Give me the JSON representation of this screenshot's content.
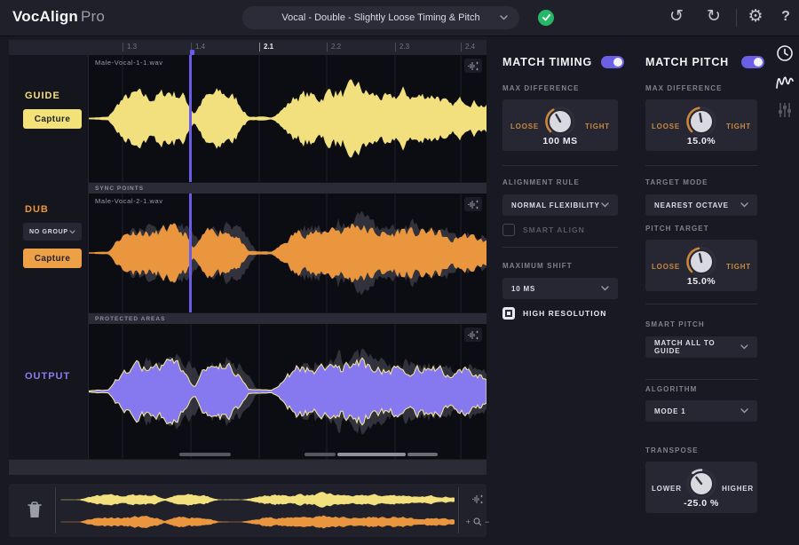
{
  "topbar": {
    "brand": "VocAlign",
    "brand_suffix": "Pro",
    "preset": "Vocal - Double - Slightly Loose Timing & Pitch",
    "icons": {
      "undo": "↺",
      "redo": "↻",
      "gear": "⚙",
      "help": "?"
    }
  },
  "timeline": {
    "ticks": [
      "1.3",
      "1.4",
      "2.1",
      "2.2",
      "2.3",
      "2.4"
    ],
    "active_index": 2
  },
  "tracks": {
    "guide": {
      "label": "GUIDE",
      "file": "Male-Vocal-1-1.wav",
      "capture_label": "Capture",
      "color": "#f1e07d"
    },
    "dub": {
      "label": "DUB",
      "group_value": "NO GROUP",
      "file": "Male-Vocal-2-1.wav",
      "capture_label": "Capture",
      "color": "#e9963f"
    },
    "output": {
      "label": "OUTPUT",
      "color": "#8b7cf0"
    },
    "sync_points_label": "SYNC POINTS",
    "protected_areas_label": "PROTECTED AREAS"
  },
  "match_timing": {
    "title": "MATCH TIMING",
    "enabled": true,
    "max_difference": {
      "label": "MAX DIFFERENCE",
      "loose": "LOOSE",
      "tight": "TIGHT",
      "value": "100 MS",
      "knob": {
        "angle": -30,
        "arc": [
          -135,
          -30
        ],
        "color": "#c8873c"
      }
    },
    "alignment_rule": {
      "label": "ALIGNMENT RULE",
      "value": "NORMAL FLEXIBILITY"
    },
    "smart_align": {
      "label": "SMART ALIGN",
      "checked": false
    },
    "maximum_shift": {
      "label": "MAXIMUM SHIFT",
      "value": "10 MS"
    },
    "high_resolution": {
      "label": "HIGH RESOLUTION",
      "checked": true
    }
  },
  "match_pitch": {
    "title": "MATCH PITCH",
    "enabled": true,
    "max_difference": {
      "label": "MAX DIFFERENCE",
      "loose": "LOOSE",
      "tight": "TIGHT",
      "value": "15.0%",
      "knob": {
        "angle": -10,
        "arc": [
          -135,
          -10
        ],
        "color": "#c8873c"
      }
    },
    "target_mode": {
      "label": "TARGET MODE",
      "value": "NEAREST OCTAVE"
    },
    "pitch_target": {
      "label": "PITCH TARGET",
      "loose": "LOOSE",
      "tight": "TIGHT",
      "value": "15.0%",
      "knob": {
        "angle": -12,
        "arc": [
          -135,
          -12
        ],
        "color": "#c8873c"
      }
    },
    "smart_pitch": {
      "label": "SMART PITCH",
      "value": "MATCH ALL TO GUIDE"
    },
    "algorithm": {
      "label": "ALGORITHM",
      "value": "MODE 1"
    },
    "transpose": {
      "label": "TRANSPOSE",
      "lower": "LOWER",
      "higher": "HIGHER",
      "value": "-25.0 %",
      "knob": {
        "angle": -38,
        "arc": [
          -38,
          0
        ],
        "color": "#cfd0d8"
      }
    }
  },
  "overview_icons": {
    "zoom_plus": "+",
    "zoom_minus": "−"
  },
  "colors": {
    "accent_purple": "#6b5ce8",
    "toggle_purple": "#6b5fe6",
    "guide_yellow": "#f1e07d",
    "dub_orange": "#e9963f",
    "output_purple": "#8678ee",
    "ok_green": "#27b768"
  }
}
